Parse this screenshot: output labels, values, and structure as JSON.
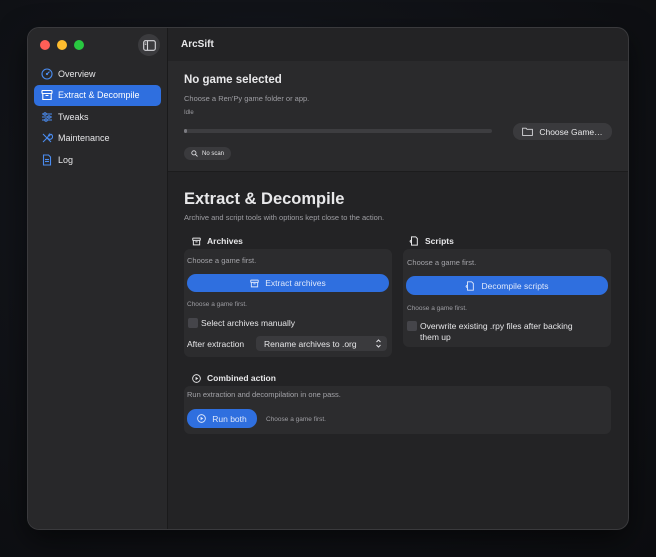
{
  "app": {
    "title": "ArcSift"
  },
  "sidebar": {
    "items": [
      {
        "label": "Overview",
        "icon": "gauge-icon"
      },
      {
        "label": "Extract & Decompile",
        "icon": "archive-box-icon",
        "active": true
      },
      {
        "label": "Tweaks",
        "icon": "sliders-icon"
      },
      {
        "label": "Maintenance",
        "icon": "wrench-icon"
      },
      {
        "label": "Log",
        "icon": "document-icon"
      }
    ]
  },
  "status": {
    "title": "No game selected",
    "subtitle": "Choose a Ren'Py game folder or app.",
    "state": "Idle",
    "progress": 0.01,
    "choose_button": "Choose Game…",
    "scan_badge": "No scan"
  },
  "page": {
    "title": "Extract & Decompile",
    "subtitle": "Archive and script tools with options kept close to the action."
  },
  "archives": {
    "heading": "Archives",
    "hint": "Choose a game first.",
    "button": "Extract archives",
    "button_hint": "Choose a game first.",
    "manual_label": "Select archives manually",
    "after_label": "After extraction",
    "after_value": "Rename archives to .org"
  },
  "scripts": {
    "heading": "Scripts",
    "hint": "Choose a game first.",
    "button": "Decompile scripts",
    "button_hint": "Choose a game first.",
    "overwrite_label_1": "Overwrite existing .rpy files after backing",
    "overwrite_label_2": "them up"
  },
  "combined": {
    "heading": "Combined action",
    "description": "Run extraction and decompilation in one pass.",
    "button": "Run both",
    "hint": "Choose a game first."
  },
  "colors": {
    "accent": "#2f6fdf",
    "window": "#232325",
    "sidebar": "#28282a"
  }
}
